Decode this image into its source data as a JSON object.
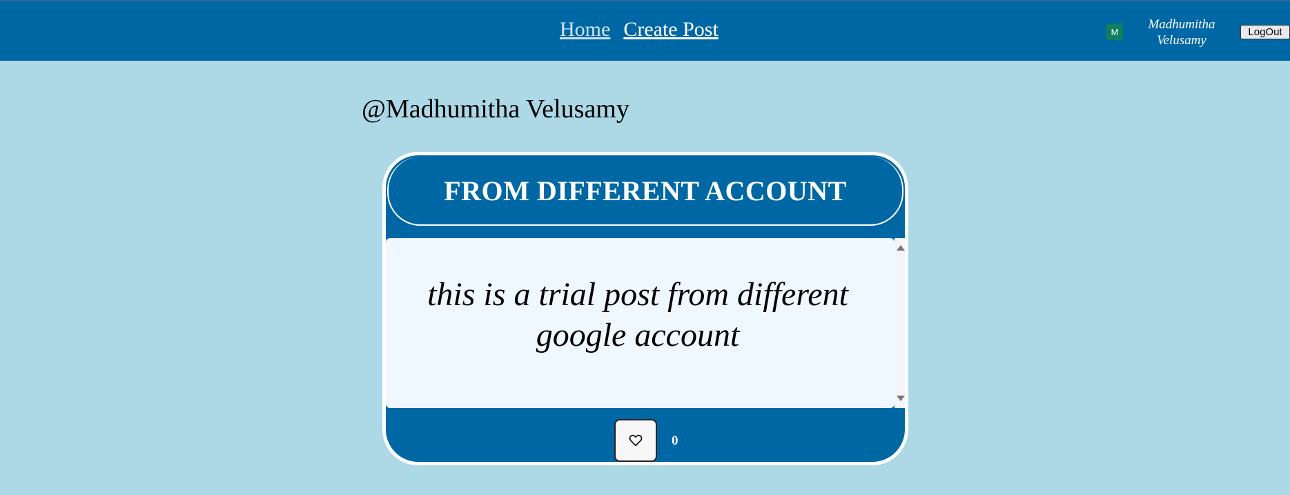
{
  "navbar": {
    "links": [
      {
        "label": "Home"
      },
      {
        "label": "Create Post"
      }
    ],
    "avatar_initial": "M",
    "user_name": "Madhumitha Velusamy",
    "logout_label": "LogOut",
    "color": "#0067a5"
  },
  "profile": {
    "handle": "@Madhumitha Velusamy"
  },
  "post": {
    "title": "FROM DIFFERENT ACCOUNT",
    "content": "this is a trial post from different google account",
    "like_count": "0",
    "like_icon": "heart-icon"
  },
  "colors": {
    "background": "#add8e6",
    "card": "#0067a5",
    "card_body": "#eff7ff"
  }
}
